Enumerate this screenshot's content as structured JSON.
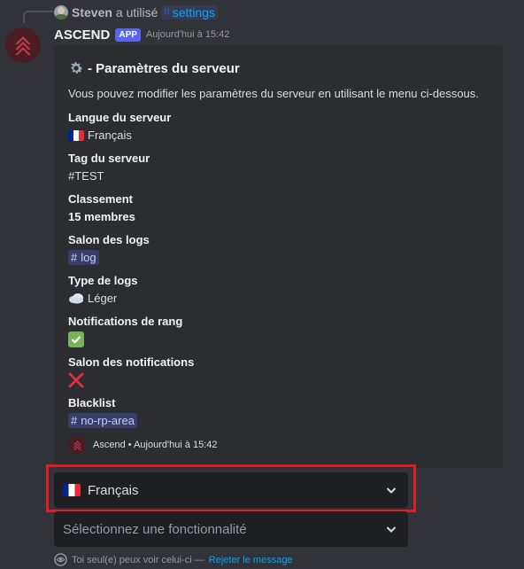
{
  "reply": {
    "user": "Steven",
    "action": "a utilisé",
    "command": "settings"
  },
  "header": {
    "bot_name": "ASCEND",
    "badge": "APP",
    "timestamp": "Aujourd'hui à 15:42"
  },
  "embed": {
    "title": "- Paramètres du serveur",
    "description": "Vous pouvez modifier les paramètres du serveur en utilisant le menu ci-dessous.",
    "fields": [
      {
        "name": "Langue du serveur",
        "value": "Français",
        "icon": "flag-fr-icon"
      },
      {
        "name": "Tag du serveur",
        "value": "#TEST"
      },
      {
        "name": "Classement",
        "value": "15 membres"
      },
      {
        "name": "Salon des logs",
        "value": "log",
        "icon": "hash-icon"
      },
      {
        "name": "Type de logs",
        "value": "Léger",
        "icon": "cloud-icon"
      },
      {
        "name": "Notifications de rang",
        "icon": "check-mark-icon"
      },
      {
        "name": "Salon des notifications",
        "icon": "cross-mark-icon"
      },
      {
        "name": "Blacklist",
        "value": "no-rp-area",
        "icon": "hash-icon"
      }
    ],
    "footer": {
      "name": "Ascend",
      "separator": "•",
      "timestamp": "Aujourd'hui à 15:42"
    }
  },
  "selects": {
    "language": {
      "value": "Français"
    },
    "feature": {
      "placeholder": "Sélectionnez une fonctionnalité"
    }
  },
  "ephemeral": {
    "text": "Toi seul(e) peux voir celui-ci —",
    "dismiss": "Rejeter le message"
  },
  "colors": {
    "background": "#313338",
    "embed": "#2b2d31",
    "accent": "#5865f2",
    "link": "#00a8fc",
    "highlight": "#e21c27"
  }
}
